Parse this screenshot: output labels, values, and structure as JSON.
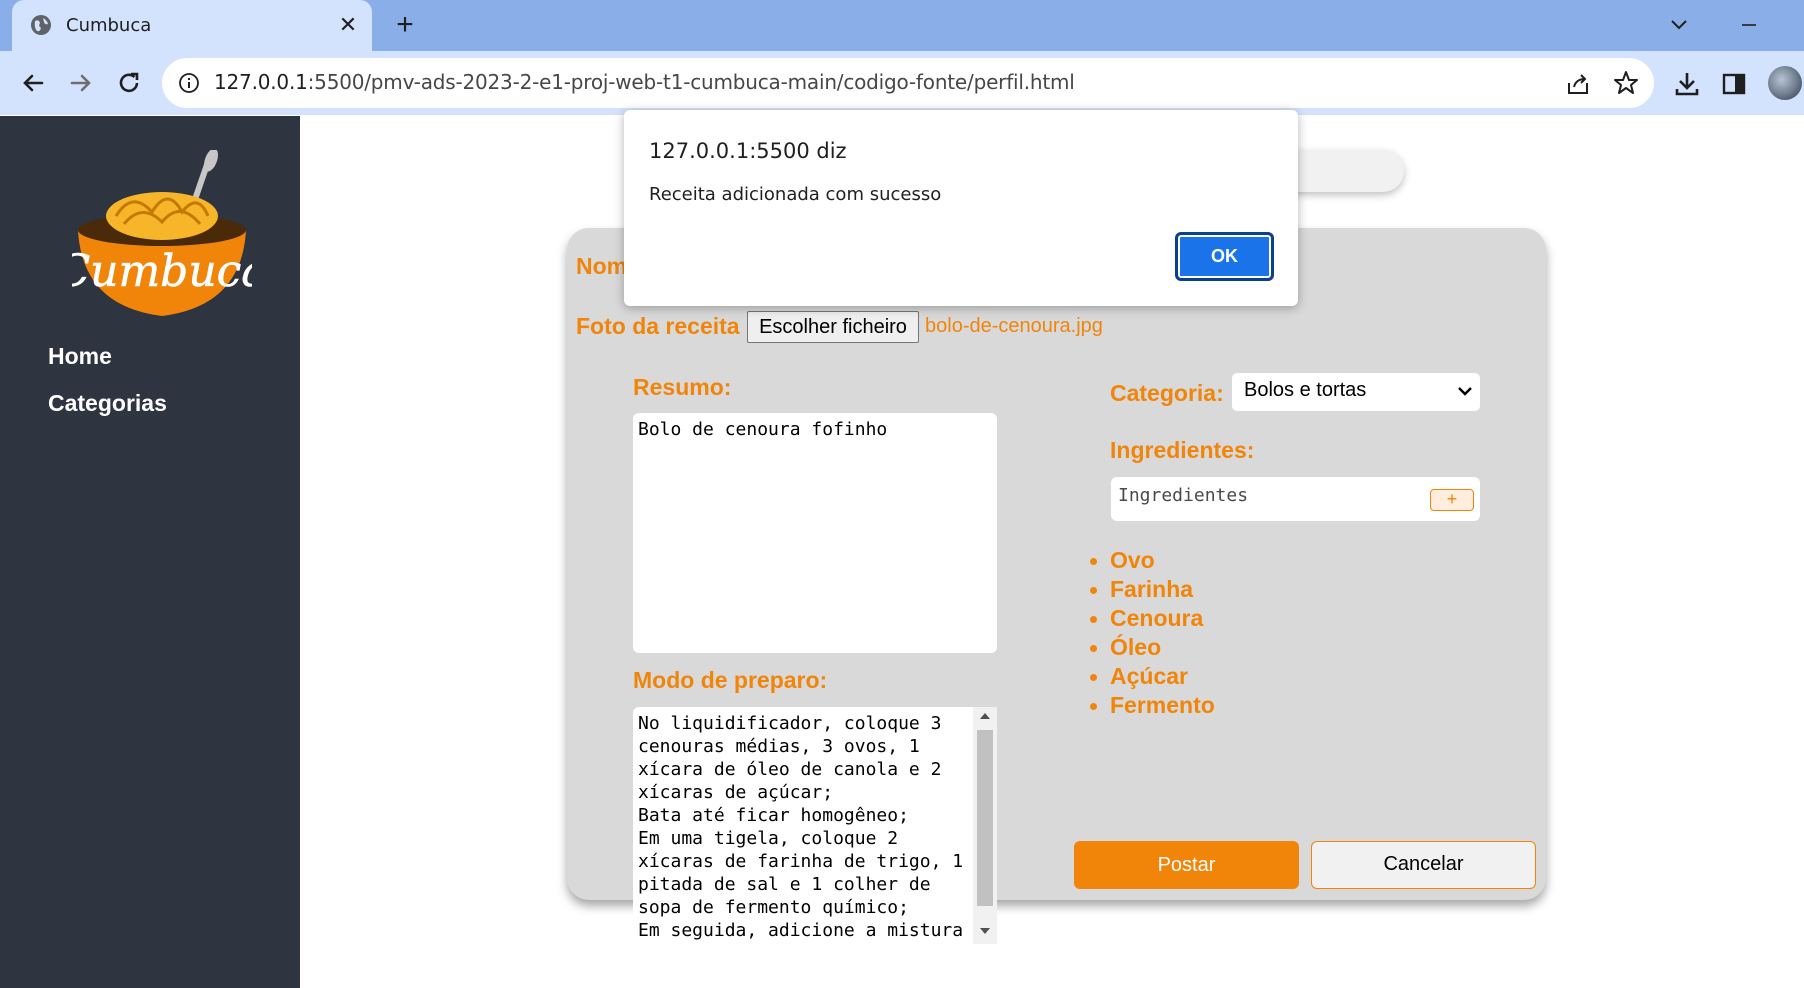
{
  "browser": {
    "tab_title": "Cumbuca",
    "url_host": "127.0.0.1",
    "url_rest": ":5500/pmv-ads-2023-2-e1-proj-web-t1-cumbuca-main/codigo-fonte/perfil.html"
  },
  "sidebar": {
    "logo_text": "Cumbuca",
    "items": [
      {
        "label": "Home"
      },
      {
        "label": "Categorias"
      }
    ]
  },
  "form": {
    "name_label": "Nom",
    "photo_label": "Foto da receita",
    "file_button": "Escolher ficheiro",
    "file_name": "bolo-de-cenoura.jpg",
    "summary_label": "Resumo:",
    "summary_value": "Bolo de cenoura fofinho",
    "method_label": "Modo de preparo:",
    "method_value": "No liquidificador, coloque 3\ncenouras médias, 3 ovos, 1\nxícara de óleo de canola e 2\nxícaras de açúcar;\nBata até ficar homogêneo;\nEm uma tigela, coloque 2\nxícaras de farinha de trigo, 1\npitada de sal e 1 colher de\nsopa de fermento químico;\nEm seguida, adicione a mistura",
    "category_label": "Categoria:",
    "category_value": "Bolos e tortas",
    "ingredients_label": "Ingredientes:",
    "ingredients_placeholder": "Ingredientes",
    "add_button": "+",
    "ingredients": [
      "Ovo",
      "Farinha",
      "Cenoura",
      "Óleo",
      "Açúcar",
      "Fermento"
    ],
    "post_button": "Postar",
    "cancel_button": "Cancelar"
  },
  "dialog": {
    "title": "127.0.0.1:5500 diz",
    "message": "Receita adicionada com sucesso",
    "ok_button": "OK"
  },
  "colors": {
    "accent": "#f0850a",
    "sidebar_bg": "#2e3440",
    "card_bg": "#d9d9d9",
    "chrome_tabbar": "#8aaee8",
    "chrome_toolbar": "#d3e3fd",
    "dialog_button": "#1a73e8"
  }
}
